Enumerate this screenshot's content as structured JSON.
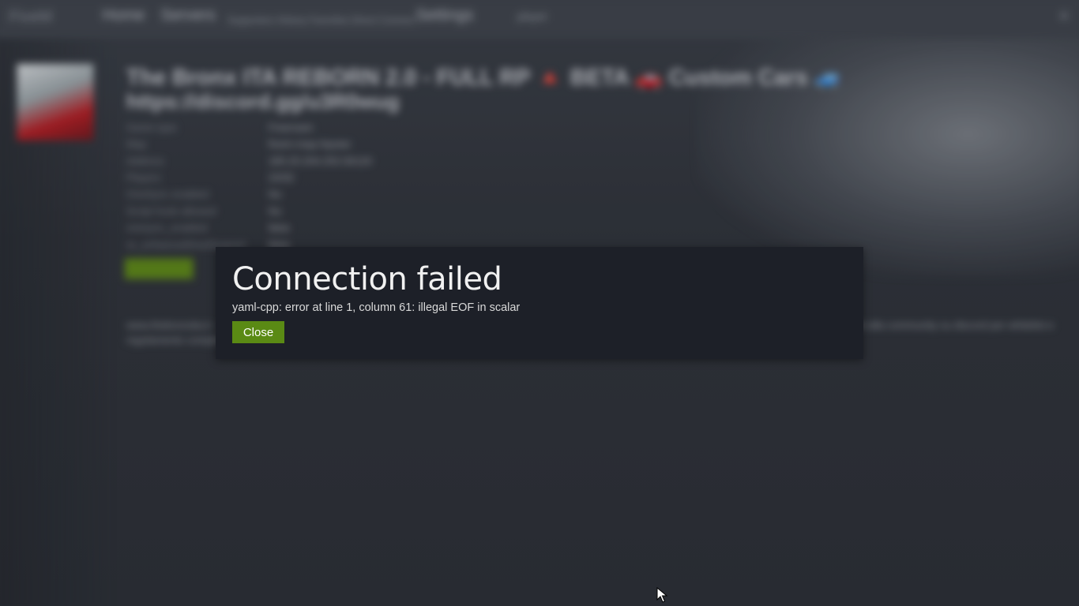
{
  "background_app": {
    "logo": "FiveM",
    "nav": [
      "Home",
      "Servers",
      "Settings"
    ],
    "subnav": "Supporters  History  Favorites  Direct Connect",
    "user": "player",
    "server_title_line1": "The Bronx ITA REBORN 2.0 - FULL RP 🔺 BETA 🚗 Custom Cars 🚙",
    "server_title_line2": "https://discord.gg/u3R0wug",
    "info_labels": [
      "Game type",
      "Map",
      "Address",
      "Players",
      "OneSync enabled",
      "Script hook allowed",
      "onesync_enabled",
      "sv_enhancedHostSupport"
    ],
    "info_values": [
      "Freeroam",
      "fivem-map-hipster",
      "185.25.204.252:30120",
      "23/32",
      "No",
      "No",
      "false",
      "false"
    ],
    "description": "www.thebronxita.it - server roleplay italiano con auto custom, lavori, gang, polizia, ems, meccanici, economia realistica, case, negozi, eventi e molto altro. Unisciti alla community su discord per whitelist e regolamento completo del server."
  },
  "modal": {
    "title": "Connection failed",
    "message": "yaml-cpp: error at line 1, column 61: illegal EOF in scalar",
    "close_label": "Close"
  },
  "colors": {
    "modal_bg": "#1d2028",
    "accent_green": "#5a8a14"
  }
}
